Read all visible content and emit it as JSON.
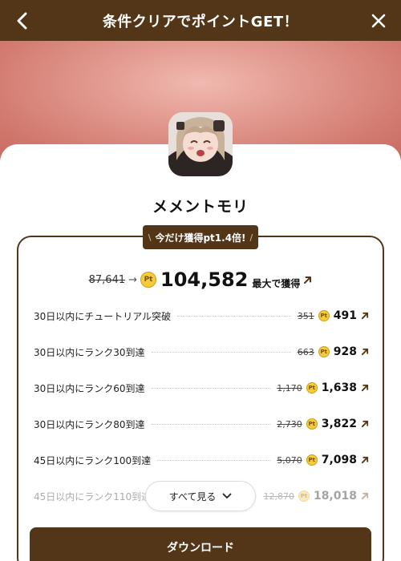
{
  "header": {
    "title": "条件クリアでポイントGET！"
  },
  "app": {
    "name": "メメントモリ"
  },
  "promo": {
    "tag": "今だけ獲得pt1.4倍!"
  },
  "total": {
    "old": "87,641",
    "value": "104,582",
    "suffix": "最大で獲得"
  },
  "conditions": [
    {
      "label": "30日以内にチュートリアル突破",
      "old": "351",
      "value": "491",
      "faded": false
    },
    {
      "label": "30日以内にランク30到達",
      "old": "663",
      "value": "928",
      "faded": false
    },
    {
      "label": "30日以内にランク60到達",
      "old": "1,170",
      "value": "1,638",
      "faded": false
    },
    {
      "label": "30日以内にランク80到達",
      "old": "2,730",
      "value": "3,822",
      "faded": false
    },
    {
      "label": "45日以内にランク100到達",
      "old": "5,070",
      "value": "7,098",
      "faded": false
    },
    {
      "label": "45日以内にランク110到達",
      "old": "12,870",
      "value": "18,018",
      "faded": true
    }
  ],
  "see_all": {
    "label": "すべて見る"
  },
  "download": {
    "label": "ダウンロード"
  },
  "icons": {
    "back": "chevron-left-icon",
    "close": "close-icon",
    "point": "pt-coin-icon",
    "up": "arrow-up-right-icon",
    "expand": "chevron-down-icon"
  },
  "colors": {
    "brand": "#533618",
    "coin": "#f3cb3c",
    "banner": "#d0776c"
  }
}
